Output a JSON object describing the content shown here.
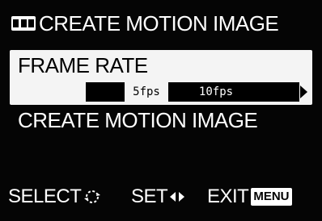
{
  "title": {
    "icon": "motion-frames-icon",
    "text": "CREATE MOTION IMAGE"
  },
  "menu": {
    "frame_rate": {
      "label": "FRAME RATE",
      "options": [
        "5fps",
        "10fps"
      ],
      "selected": "5fps"
    },
    "create_motion_image": {
      "label": "CREATE MOTION IMAGE"
    }
  },
  "footer": {
    "select_label": "SELECT",
    "select_icon": "control-dial-icon",
    "set_label": "SET",
    "set_icon": "left-right-arrows-icon",
    "exit_label": "EXIT",
    "menu_badge": "MENU"
  },
  "colors": {
    "background": "#050505",
    "highlight": "#f4f4f4",
    "text": "#ffffff"
  }
}
